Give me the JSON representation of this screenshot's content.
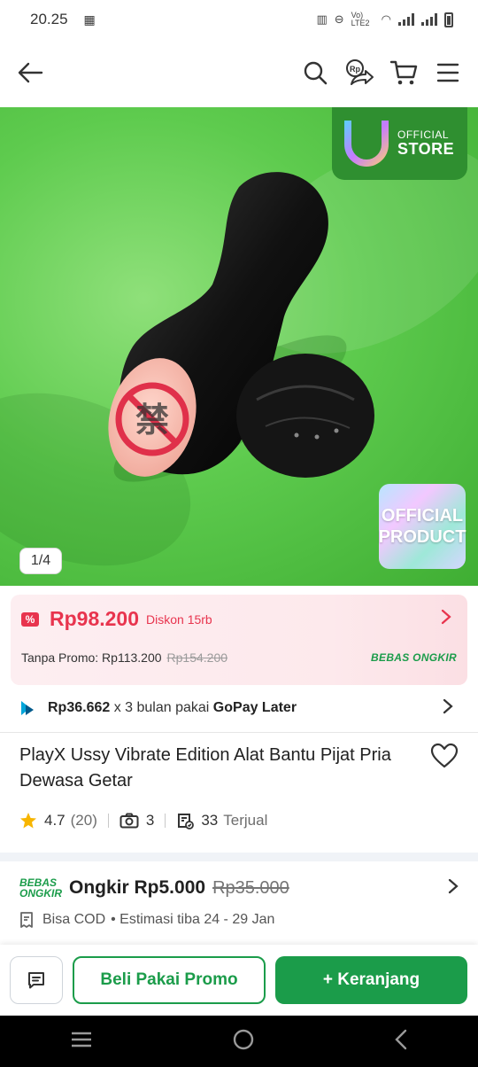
{
  "status_bar": {
    "time": "20.25",
    "network": "Vo) LTE2"
  },
  "header": {
    "icons": [
      "back-arrow-icon",
      "search-icon",
      "rp-share-icon",
      "cart-icon",
      "menu-icon"
    ]
  },
  "hero": {
    "badge_line1": "OFFICIAL",
    "badge_line2": "STORE",
    "official_product_line1": "OFFICIAL",
    "official_product_line2": "PRODUCT",
    "counter": "1/4"
  },
  "price": {
    "main": "Rp98.200",
    "discount": "Diskon 15rb",
    "promo_label": "Tanpa Promo: Rp113.200",
    "original": "Rp154.200",
    "free_shipping": "BEBAS ONGKIR"
  },
  "gopay": {
    "amount": "Rp36.662",
    "middle": " x 3 bulan pakai ",
    "brand": "GoPay Later"
  },
  "product": {
    "title": "PlayX Ussy Vibrate Edition Alat Bantu Pijat Pria Dewasa Getar",
    "rating": "4.7",
    "reviews": "(20)",
    "photos": "3",
    "sold_count": "33",
    "sold_label": "Terjual"
  },
  "shipping": {
    "logo_line1": "BEBAS",
    "logo_line2": "ONGKIR",
    "label": "Ongkir Rp5.000",
    "original": "Rp35.000",
    "cod": "Bisa COD",
    "eta": "• Estimasi tiba 24 - 29 Jan"
  },
  "bottom": {
    "promo_button": "Beli Pakai Promo",
    "cart_button": "+ Keranjang"
  },
  "colors": {
    "brand_green": "#1b9c4a",
    "price_red": "#e8344e",
    "star": "#f7b500"
  }
}
